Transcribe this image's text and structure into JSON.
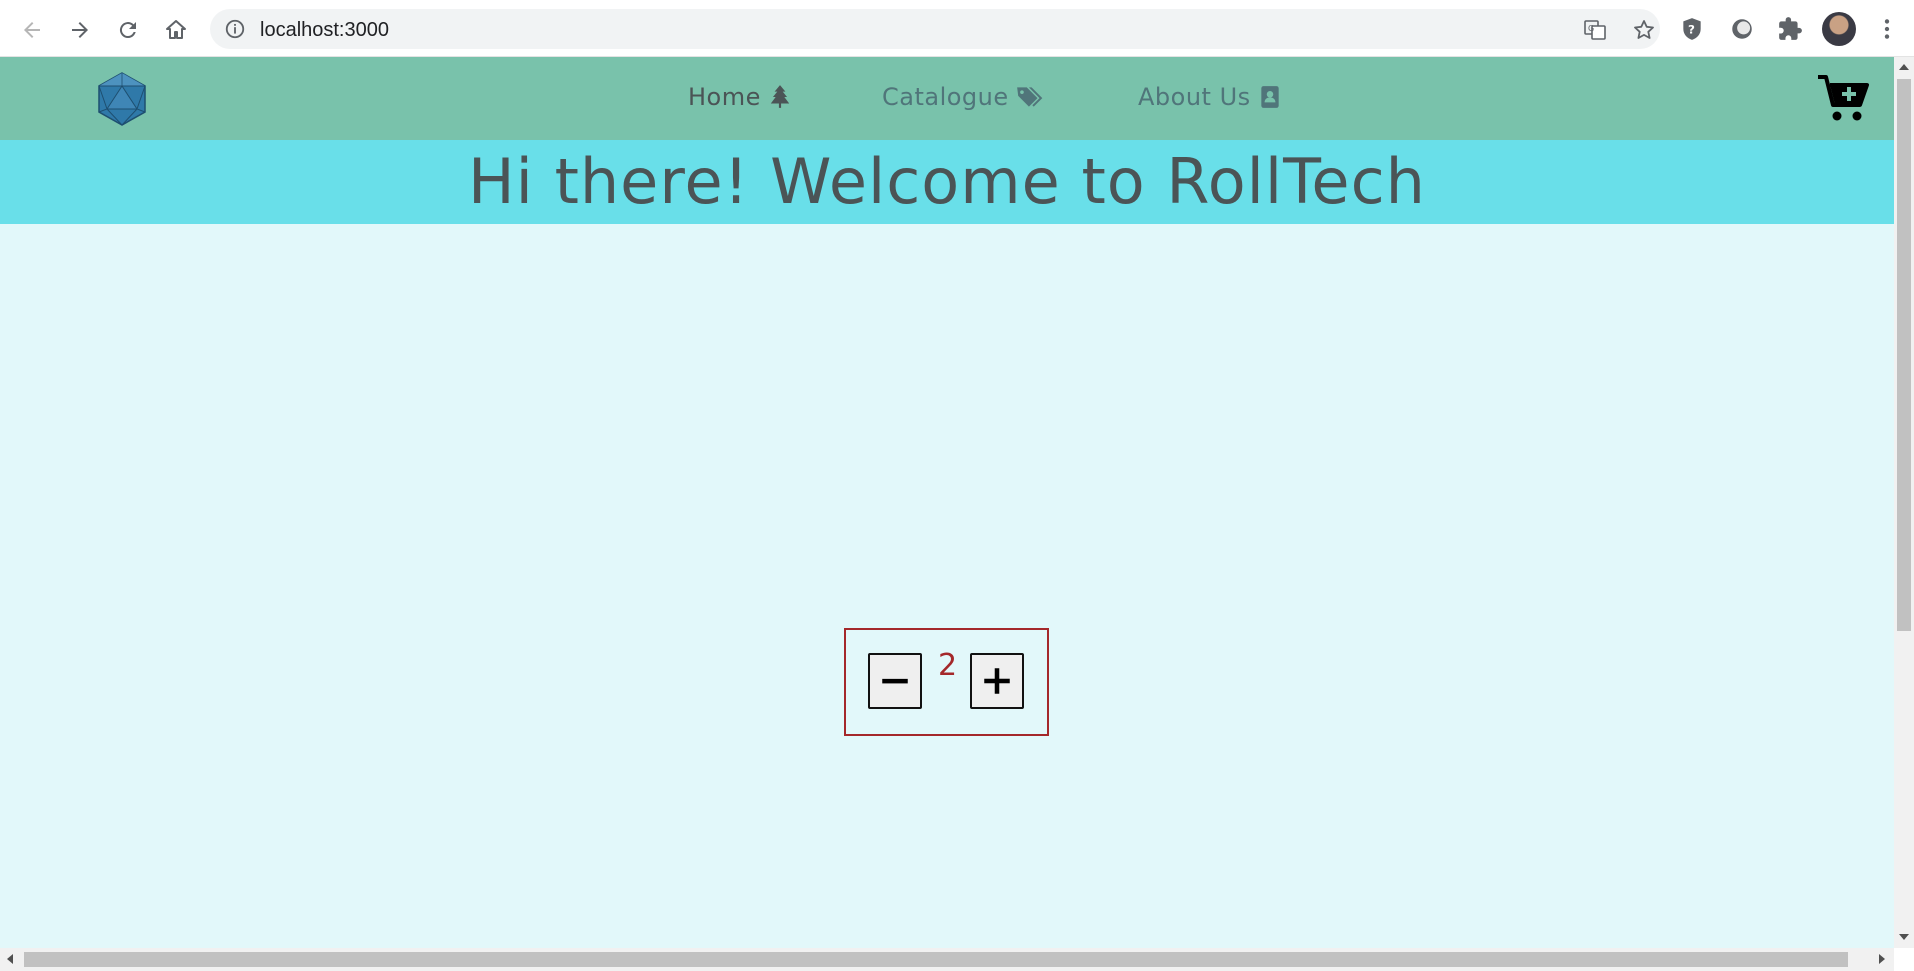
{
  "browser": {
    "url": "localhost:3000"
  },
  "nav": {
    "home_label": "Home",
    "catalogue_label": "Catalogue",
    "about_label": "About Us"
  },
  "banner": {
    "heading": "Hi there! Welcome to RollTech"
  },
  "counter": {
    "value": "2"
  },
  "icons": {
    "logo": "d20-dice-icon",
    "home": "tree-icon",
    "catalogue": "tags-icon",
    "about": "address-book-icon",
    "cart": "cart-plus-icon",
    "decrement": "minus-icon",
    "increment": "plus-icon"
  },
  "colors": {
    "header_bg": "#79c2ab",
    "banner_bg": "#69dfe9",
    "page_bg": "#e2f8fa",
    "counter_accent": "#a4282a",
    "heading_text": "#4b5456"
  }
}
